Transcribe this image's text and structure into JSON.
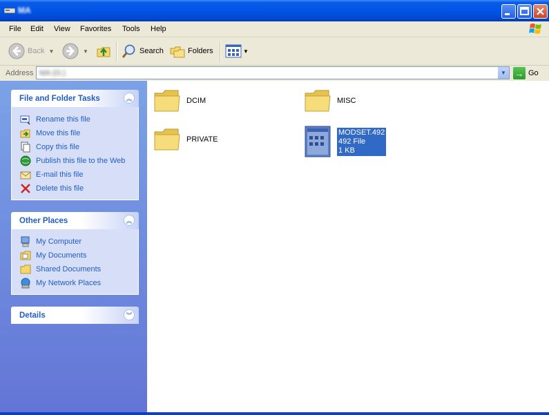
{
  "window": {
    "title": "MA"
  },
  "menu": [
    "File",
    "Edit",
    "View",
    "Favorites",
    "Tools",
    "Help"
  ],
  "toolbar": {
    "back_label": "Back",
    "search_label": "Search",
    "folders_label": "Folders"
  },
  "address": {
    "label": "Address",
    "value": "MA (G:)",
    "go_label": "Go"
  },
  "file_tasks": {
    "title": "File and Folder Tasks",
    "items": [
      {
        "label": "Rename this file",
        "icon": "rename-icon"
      },
      {
        "label": "Move this file",
        "icon": "move-icon"
      },
      {
        "label": "Copy this file",
        "icon": "copy-icon"
      },
      {
        "label": "Publish this file to the Web",
        "icon": "web-publish-icon"
      },
      {
        "label": "E-mail this file",
        "icon": "email-icon"
      },
      {
        "label": "Delete this file",
        "icon": "delete-icon"
      }
    ]
  },
  "other_places": {
    "title": "Other Places",
    "items": [
      {
        "label": "My Computer",
        "icon": "my-computer-icon"
      },
      {
        "label": "My Documents",
        "icon": "my-documents-icon"
      },
      {
        "label": "Shared Documents",
        "icon": "shared-documents-icon"
      },
      {
        "label": "My Network Places",
        "icon": "network-places-icon"
      }
    ]
  },
  "details": {
    "title": "Details"
  },
  "files": [
    {
      "name": "DCIM",
      "type": "folder"
    },
    {
      "name": "MISC",
      "type": "folder"
    },
    {
      "name": "PRIVATE",
      "type": "folder"
    },
    {
      "name": "MODSET.492",
      "type": "file",
      "line2": "492 File",
      "line3": "1 KB",
      "selected": true
    }
  ],
  "colors": {
    "titlebar": "#0055e5",
    "taskpane_link": "#215dc6",
    "selection": "#316ac5"
  }
}
